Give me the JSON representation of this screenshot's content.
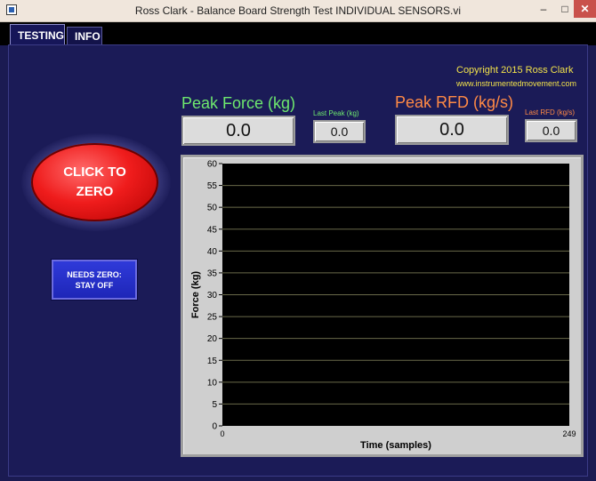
{
  "window": {
    "title": "Ross Clark - Balance Board Strength Test INDIVIDUAL SENSORS.vi",
    "minimize": "–",
    "maximize": "□",
    "close": "✕"
  },
  "tabs": [
    {
      "label": "TESTING",
      "active": true
    },
    {
      "label": "INFO",
      "active": false
    }
  ],
  "credits": {
    "copyright": "Copyright 2015 Ross Clark",
    "website": "www.instrumentedmovement.com"
  },
  "peak_force": {
    "label": "Peak Force (kg)",
    "value": "0.0",
    "last_label": "Last Peak (kg)",
    "last_value": "0.0"
  },
  "peak_rfd": {
    "label": "Peak RFD (kg/s)",
    "value": "0.0",
    "last_label": "Last RFD (kg/s)",
    "last_value": "0.0"
  },
  "zero_button": {
    "label": "CLICK TO ZERO"
  },
  "status": {
    "label": "NEEDS ZERO: STAY OFF"
  },
  "colors": {
    "force": "#6ee86e",
    "rfd": "#ff8a45",
    "zero_button": "#ef1c1c",
    "status": "#2f3ad9",
    "credits": "#f3e34a"
  },
  "chart_data": {
    "type": "line",
    "title": "",
    "xlabel": "Time (samples)",
    "ylabel": "Force (kg)",
    "xlim": [
      0,
      249
    ],
    "ylim": [
      0,
      60
    ],
    "x_ticks": [
      0,
      249
    ],
    "y_ticks": [
      0,
      5,
      10,
      15,
      20,
      25,
      30,
      35,
      40,
      45,
      50,
      55,
      60
    ],
    "grid": true,
    "series": []
  }
}
